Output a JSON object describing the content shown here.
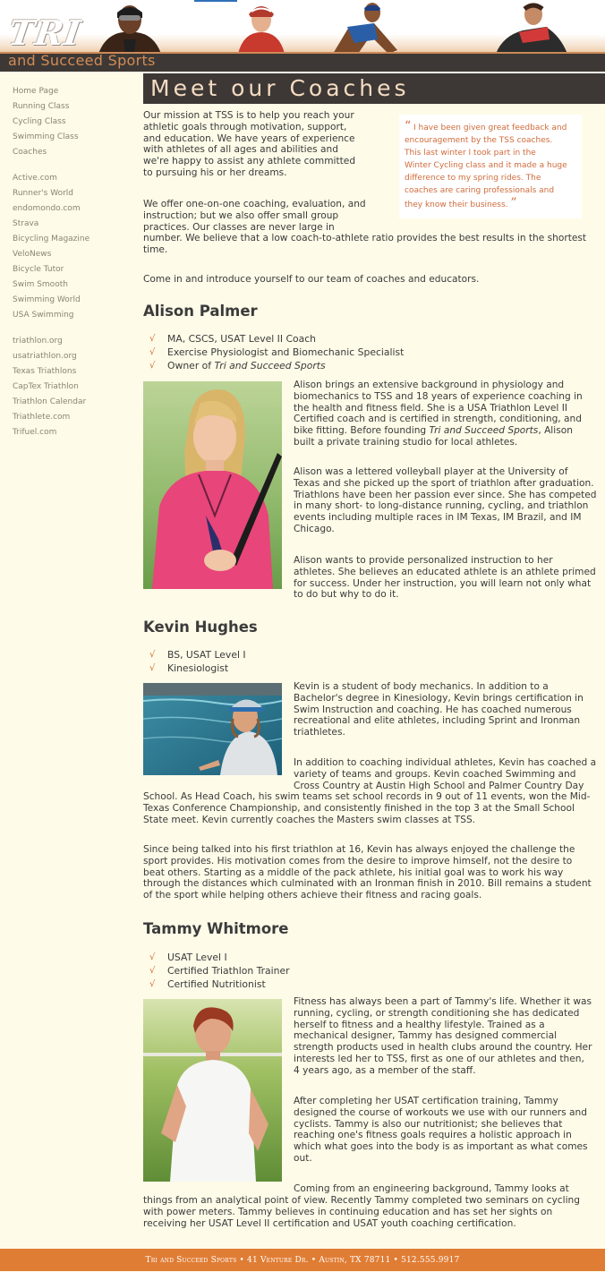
{
  "brand": {
    "main": "TRI",
    "sub": "and Succeed Sports"
  },
  "nav": {
    "group1": [
      "Home Page",
      "Running Class",
      "Cycling Class",
      "Swimming Class",
      "Coaches"
    ],
    "group2": [
      "Active.com",
      "Runner's World",
      "endomondo.com",
      "Strava",
      "Bicycling Magazine",
      "VeloNews",
      "Bicycle Tutor",
      "Swim Smooth",
      "Swimming World",
      "USA Swimming"
    ],
    "group3": [
      "triathlon.org",
      "usatriathlon.org",
      "Texas Triathlons",
      "CapTex Triathlon",
      "Triathlon Calendar",
      "Triathlete.com",
      "Trifuel.com"
    ]
  },
  "page_title": "Meet our Coaches",
  "intro": {
    "p1": "Our mission at TSS is to help you reach your athletic goals through motivation, support, and education. We have years of experience with athletes of all ages and abilities and we're happy to assist any athlete committed to pursuing his or her dreams.",
    "p2_lines": [
      "We offer one-on-one coaching, evaluation, and",
      "instruction; but we also offer small group",
      "practices. Our classes are never large in",
      "number. We believe that a low coach-to-athlete ratio provides the best results in the shortest",
      "time."
    ],
    "p3": "Come in and introduce yourself to our team of coaches and educators."
  },
  "testimonial": {
    "lines": [
      "I have been given great feedback and",
      "encouragement by the TSS coaches.",
      "This last winter I took part in the",
      "Winter Cycling class and it made a huge",
      "difference to my spring rides. The",
      "coaches are caring professionals and",
      "they know their business."
    ],
    "open_mark": "“",
    "close_mark": "”"
  },
  "coaches": [
    {
      "name": "Alison Palmer",
      "creds": [
        "MA, CSCS, USAT Level II Coach",
        "Exercise Physiologist and Biomechanic Specialist"
      ],
      "owner_prefix": "Owner of ",
      "owner_italic": "Tri and Succeed Sports",
      "bio": [
        [
          "Alison brings an extensive background in physiology and",
          "biomechanics to TSS and 18 years of experience coaching in",
          "the health and fitness field. She is a USA Triathlon Level II",
          "Certified coach and is certified in strength, conditioning, and"
        ],
        [
          "Alison was a lettered volleyball player at the University of",
          "Texas and she picked up the sport of triathlon after graduation.",
          "Triathlons have been her passion ever since. She has competed",
          "in many short- to long-distance running, cycling, and triathlon",
          "events including multiple races in IM Texas, IM Brazil, and IM",
          "Chicago."
        ],
        [
          "Alison wants to provide personalized instruction to her",
          "athletes. She believes an educated athlete is an athlete primed",
          "for success. Under her instruction, you will learn not only what",
          "to do but why to do it."
        ]
      ],
      "bio1_tail_pre": "bike fitting. Before founding ",
      "bio1_tail_italic": "Tri and Succeed Sports",
      "bio1_tail_post": ", Alison",
      "bio1_last": "built a private training studio for local athletes."
    },
    {
      "name": "Kevin Hughes",
      "creds": [
        "BS, USAT Level I",
        "Kinesiologist"
      ],
      "bio": [
        [
          "Kevin is a student of body mechanics. In addition to a",
          "Bachelor's degree in Kinesiology, Kevin brings certification in",
          "Swim Instruction and coaching. He has coached numerous",
          "recreational and elite athletes, including Sprint and Ironman",
          "triathletes."
        ],
        [
          "In addition to coaching individual athletes, Kevin has coached a",
          "variety of teams and groups. Kevin coached Swimming and",
          "Cross Country at Austin High School and Palmer Country Day"
        ],
        [
          "School. As Head Coach, his swim teams set school records in 9 out of 11 events, won the Mid-",
          "Texas Conference Championship, and consistently finished in the top 3 at the Small School",
          "State meet. Kevin currently coaches the Masters swim classes at TSS."
        ],
        [
          "Since being talked into his first triathlon at 16, Kevin has always enjoyed the challenge the",
          "sport provides. His motivation comes from the desire to improve himself, not the desire to",
          "beat others. Starting as a middle of the pack athlete, his initial goal was to work his way",
          "through the distances which culminated with an Ironman finish in 2010. Bill remains a student",
          "of the sport while helping others achieve their fitness and racing goals."
        ]
      ]
    },
    {
      "name": "Tammy Whitmore",
      "creds": [
        "USAT Level I",
        "Certified Triathlon Trainer",
        "Certified Nutritionist"
      ],
      "bio": [
        [
          "Fitness has always been a part of Tammy's life. Whether it was",
          "running, cycling, or strength conditioning she has dedicated",
          "herself to fitness and a healthy lifestyle. Trained as a",
          "mechanical designer, Tammy has designed commercial",
          "strength products used in health clubs around the country. Her",
          "interests led her to TSS, first as one of our athletes and then,",
          "4 years ago, as a member of the staff."
        ],
        [
          "After completing her USAT certification training, Tammy",
          "designed the course of workouts we use with our runners and",
          "cyclists. Tammy is also our nutritionist; she believes that",
          "reaching one's fitness goals requires a holistic approach in",
          "which what goes into the body is as important as what comes",
          "out."
        ],
        [
          "Coming from an engineering background, Tammy looks at",
          "things from an analytical point of view. Recently Tammy completed two seminars on cycling",
          "with power meters. Tammy believes in continuing education and has set her sights on",
          "receiving her USAT Level II certification and USAT youth coaching certification."
        ]
      ]
    }
  ],
  "footer": "Tri and Succeed Sports • 41 Venture Dr. • Austin, TX 78711 • 512.555.9917",
  "colors": {
    "accent": "#e07d35",
    "dark": "#3d3835",
    "background": "#fefbe8",
    "quote_text": "#cf6b3a"
  }
}
